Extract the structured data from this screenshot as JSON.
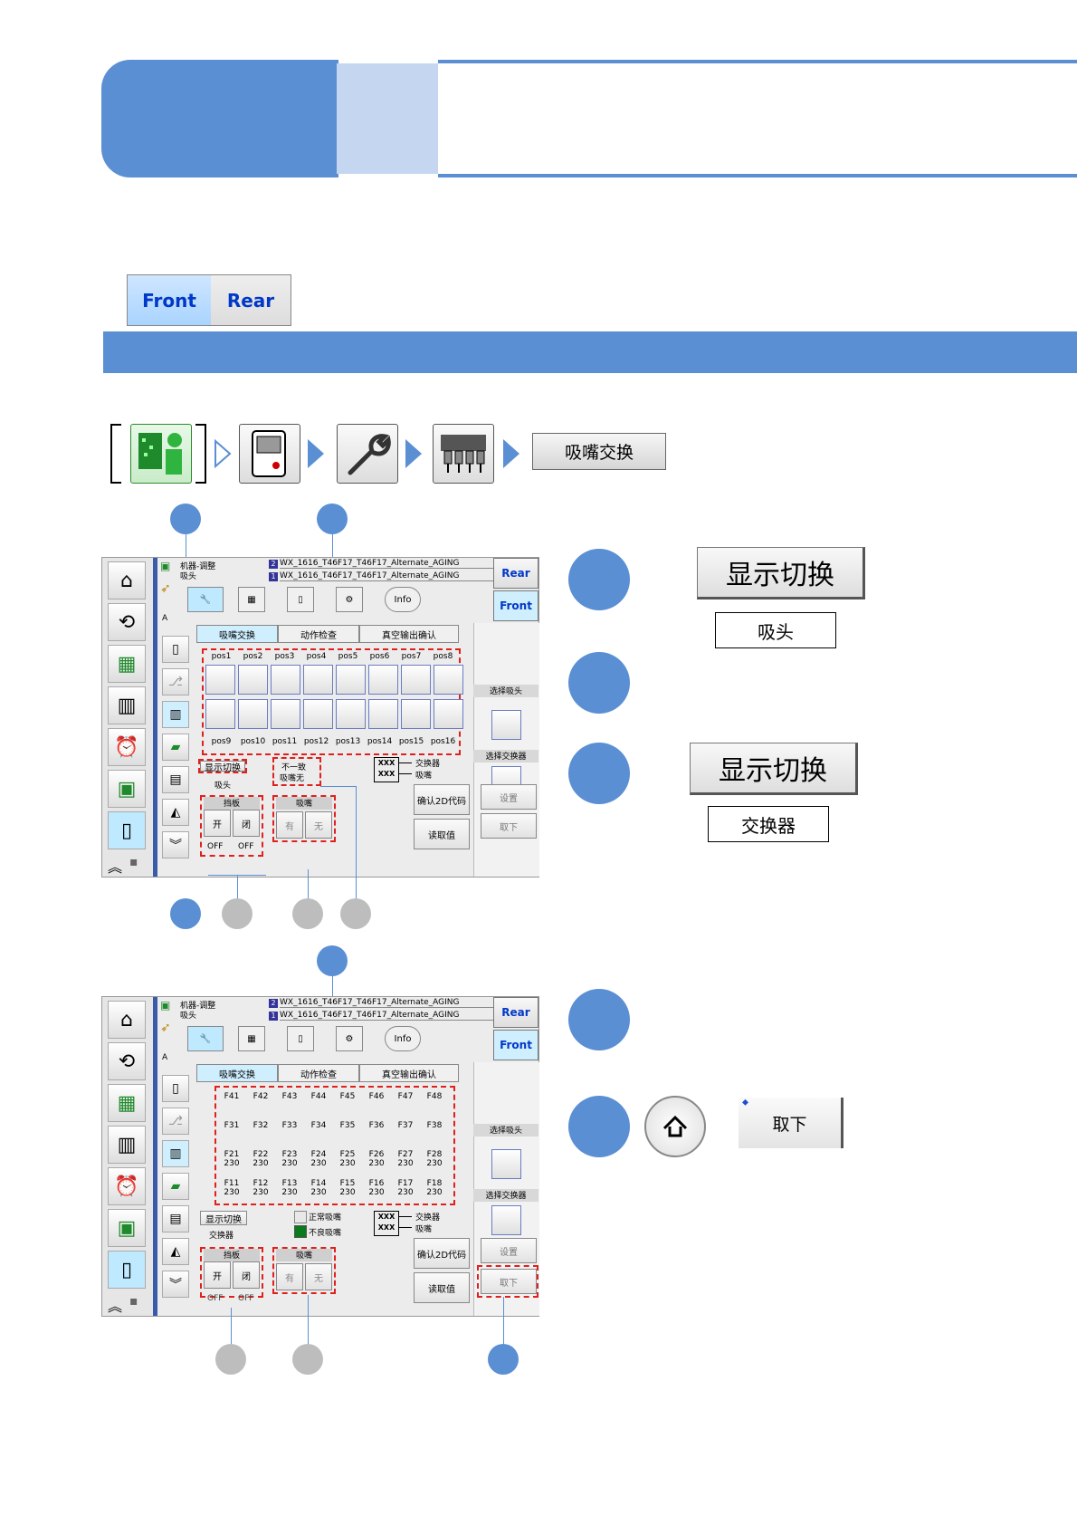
{
  "toggle": {
    "front": "Front",
    "rear": "Rear"
  },
  "nav_button": "吸嘴交换",
  "screen1": {
    "header_line1": "机器-调整",
    "header_line2": "吸头",
    "prog1": "WX_1616_T46F17_T46F17_Alternate_AGING",
    "prog2": "WX_1616_T46F17_T46F17_Alternate_AGING",
    "rear": "Rear",
    "front": "Front",
    "tab_a": "A",
    "tabs": [
      "吸嘴交换",
      "动作检查",
      "真空输出确认"
    ],
    "pos_top": [
      "pos1",
      "pos2",
      "pos3",
      "pos4",
      "pos5",
      "pos6",
      "pos7",
      "pos8"
    ],
    "pos_bottom": [
      "pos9",
      "pos10",
      "pos11",
      "pos12",
      "pos13",
      "pos14",
      "pos15",
      "pos16"
    ],
    "select_head": "选择吸头",
    "select_changer": "选择交换器",
    "display_switch": "显示切换",
    "display_value": "吸头",
    "mismatch_line1": "不一致",
    "mismatch_line2": "吸嘴无",
    "legend_xxx": "XXX",
    "legend_changer": "交换器",
    "legend_nozzle": "吸嘴",
    "shutter": "挡板",
    "open": "开",
    "close": "闭",
    "off1": "OFF",
    "off2": "OFF",
    "nozzle": "吸嘴",
    "has": "有",
    "none": "无",
    "confirm_2d": "确认2D代码",
    "read_value": "读取值",
    "setup": "设置",
    "remove": "取下"
  },
  "screen2": {
    "header_line1": "机器-调整",
    "header_line2": "吸头",
    "prog1": "WX_1616_T46F17_T46F17_Alternate_AGING",
    "prog2": "WX_1616_T46F17_T46F17_Alternate_AGING",
    "rear": "Rear",
    "front": "Front",
    "tab_a": "A",
    "tabs": [
      "吸嘴交换",
      "动作检查",
      "真空输出确认"
    ],
    "rows": [
      [
        [
          "F41",
          ""
        ],
        [
          "F42",
          ""
        ],
        [
          "F43",
          ""
        ],
        [
          "F44",
          ""
        ],
        [
          "F45",
          ""
        ],
        [
          "F46",
          ""
        ],
        [
          "F47",
          ""
        ],
        [
          "F48",
          ""
        ]
      ],
      [
        [
          "F31",
          ""
        ],
        [
          "F32",
          ""
        ],
        [
          "F33",
          ""
        ],
        [
          "F34",
          ""
        ],
        [
          "F35",
          ""
        ],
        [
          "F36",
          ""
        ],
        [
          "F37",
          ""
        ],
        [
          "F38",
          ""
        ]
      ],
      [
        [
          "F21",
          "230"
        ],
        [
          "F22",
          "230"
        ],
        [
          "F23",
          "230"
        ],
        [
          "F24",
          "230"
        ],
        [
          "F25",
          "230"
        ],
        [
          "F26",
          "230"
        ],
        [
          "F27",
          "230"
        ],
        [
          "F28",
          "230"
        ]
      ],
      [
        [
          "F11",
          "230"
        ],
        [
          "F12",
          "230"
        ],
        [
          "F13",
          "230"
        ],
        [
          "F14",
          "230"
        ],
        [
          "F15",
          "230"
        ],
        [
          "F16",
          "230"
        ],
        [
          "F17",
          "230"
        ],
        [
          "F18",
          "230"
        ]
      ]
    ],
    "select_head": "选择吸头",
    "select_changer": "选择交换器",
    "display_switch": "显示切换",
    "display_value": "交换器",
    "normal_nozzle": "正常吸嘴",
    "bad_nozzle": "不良吸嘴",
    "legend_xxx": "XXX",
    "legend_changer": "交换器",
    "legend_nozzle": "吸嘴",
    "shutter": "挡板",
    "open": "开",
    "close": "闭",
    "off1": "OFF",
    "off2": "OFF",
    "nozzle": "吸嘴",
    "has": "有",
    "none": "无",
    "confirm_2d": "确认2D代码",
    "read_value": "读取值",
    "setup": "设置",
    "remove": "取下"
  },
  "callouts": {
    "btn_display_switch_1": "显示切换",
    "label_head": "吸头",
    "btn_display_switch_2": "显示切换",
    "label_changer": "交换器",
    "btn_remove": "取下"
  },
  "colors": {
    "accent": "#5b8fd3",
    "accent_light": "#c5d7f0",
    "dash": "#e0201c",
    "gray_dot": "#bdbdbd"
  }
}
